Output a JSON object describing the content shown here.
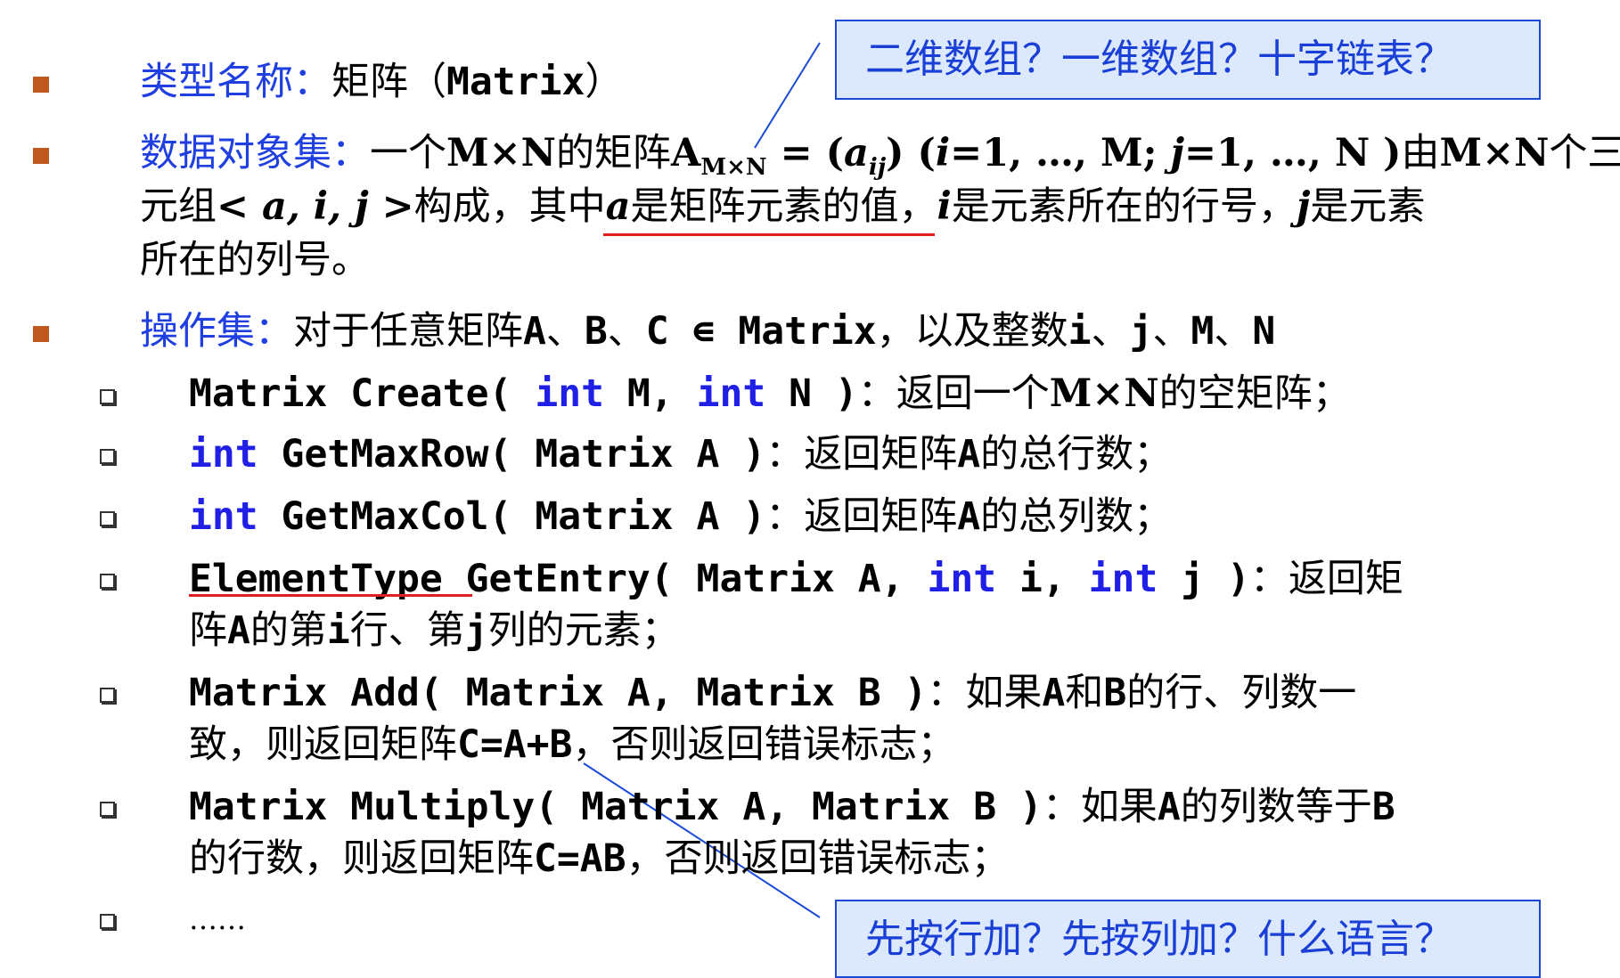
{
  "callouts": {
    "top": "二维数组？一维数组？十字链表？",
    "bottom": "先按行加？先按列加？什么语言？"
  },
  "type_name": {
    "label": "类型名称：",
    "text": "矩阵（",
    "code": "Matrix",
    "close": "）"
  },
  "data_objects": {
    "label": "数据对象集：",
    "t1": "一个",
    "t2": "M×N",
    "t3": "的矩阵",
    "t4": "A",
    "sub": "M×N",
    "t5": " = (",
    "t6": "a",
    "sub2": "ij",
    "t7": ")  (",
    "t8": "i",
    "t9": "=1, …, M; ",
    "t10": "j",
    "t11": "=1, …, N )",
    "t12": "由",
    "t13": "M×N",
    "t14": "个三",
    "l2a": "元组",
    "l2b": "< a, i, j >",
    "l2c": "构成，其中",
    "l2d": "a",
    "l2e": "是矩阵元素的值，",
    "l2f": "i",
    "l2g": "是元素所在的行号，",
    "l2h": "j",
    "l2i": "是元素",
    "l3": "所在的列号。"
  },
  "ops": {
    "label": "操作集：",
    "t1": "对于任意矩阵",
    "t2": "A",
    "t3": "、",
    "t4": "B",
    "t5": "、",
    "t6": "C ∊ Matrix",
    "t7": "，以及整数",
    "t8": "i",
    "t9": "、",
    "t10": "j",
    "t11": "、",
    "t12": "M",
    "t13": "、",
    "t14": "N",
    "items": [
      {
        "code1": "Matrix Create( ",
        "kw1": "int",
        "code2": " M, ",
        "kw2": "int",
        "code3": " N )",
        "desc": "：返回一个",
        "desc_b": "M×N",
        "desc2": "的空矩阵；"
      },
      {
        "kw1": "int",
        "code1": " GetMaxRow( Matrix A )",
        "desc": "：返回矩阵",
        "desc_b": "A",
        "desc2": "的总行数；"
      },
      {
        "kw1": "int",
        "code1": " GetMaxCol( Matrix A )",
        "desc": "：返回矩阵",
        "desc_b": "A",
        "desc2": "的总列数；"
      },
      {
        "code0": "ElementType",
        "code1": " GetEntry( Matrix A, ",
        "kw1": "int",
        "code2": " i, ",
        "kw2": "int",
        "code3": " j )",
        "desc": "：返回矩",
        "l2a": "阵",
        "l2b": "A",
        "l2c": "的第",
        "l2d": "i",
        "l2e": "行、第",
        "l2f": "j",
        "l2g": "列的元素；"
      },
      {
        "code1": "Matrix Add( Matrix A, Matrix B )",
        "desc": "：如果",
        "desc_b": "A",
        "desc2": "和",
        "desc_b2": "B",
        "desc3": "的行、列数一",
        "l2a": "致，则返回矩阵",
        "l2b": "C=A+B",
        "l2c": "，否则返回错误标志；"
      },
      {
        "code1": "Matrix Multiply( Matrix A, Matrix B )",
        "desc": "：如果",
        "desc_b": "A",
        "desc2": "的列数等于",
        "desc_b2": "B",
        "l2a": "的行数，则返回矩阵",
        "l2b": "C=AB",
        "l2c": "，否则返回错误标志；"
      },
      {
        "text": "……"
      }
    ]
  }
}
